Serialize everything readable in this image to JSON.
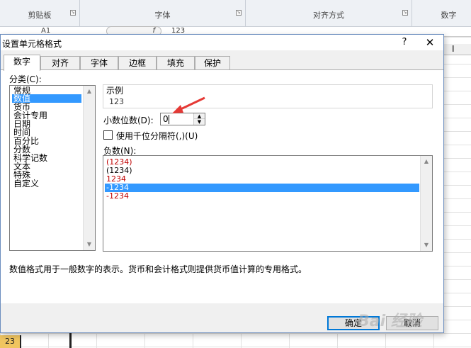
{
  "ribbon": {
    "groups": [
      "剪贴板",
      "字体",
      "对齐方式",
      "数字"
    ],
    "name_box": "A1",
    "fx": "f",
    "formula_value": "123"
  },
  "sheet": {
    "row_number": "23",
    "column_marker": "I"
  },
  "dialog": {
    "title": "设置单元格格式",
    "help": "?",
    "close": "✕",
    "tabs": [
      "数字",
      "对齐",
      "字体",
      "边框",
      "填充",
      "保护"
    ],
    "active_tab": "数字",
    "category_label": "分类(C):",
    "categories": [
      "常规",
      "数值",
      "货币",
      "会计专用",
      "日期",
      "时间",
      "百分比",
      "分数",
      "科学记数",
      "文本",
      "特殊",
      "自定义"
    ],
    "selected_category": "数值",
    "sample_label": "示例",
    "sample_value": "123",
    "decimal_label": "小数位数(D):",
    "decimal_value": "0",
    "thousands_label": "使用千位分隔符(,)(U)",
    "thousands_checked": false,
    "negative_label": "负数(N):",
    "negative_options": [
      {
        "text": "(1234)",
        "color": "#c00000"
      },
      {
        "text": "(1234)",
        "color": "#000000"
      },
      {
        "text": "1234",
        "color": "#c00000"
      },
      {
        "text": "-1234",
        "color": "#ffffff"
      },
      {
        "text": "-1234",
        "color": "#c00000"
      }
    ],
    "selected_negative_index": 3,
    "description": "数值格式用于一般数字的表示。货币和会计格式则提供货币值计算的专用格式。",
    "ok_label": "确定",
    "cancel_label": "取消"
  },
  "watermark": "Bai 经验",
  "colors": {
    "selection": "#3399ff",
    "accent_border": "#0078d7",
    "annotation_arrow": "#e53935",
    "negative_red": "#c00000"
  }
}
